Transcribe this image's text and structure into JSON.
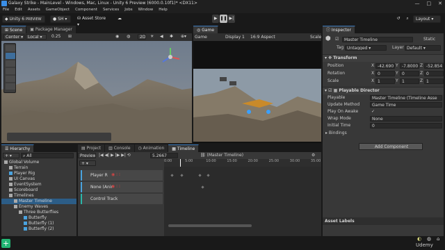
{
  "window": {
    "title": "Galaxy Strike - MainLevel - Windows, Mac, Linux - Unity 6 Preview (6000.0.10f1)* <DX11>",
    "controls": [
      "—",
      "□",
      "✕"
    ]
  },
  "menu": [
    "File",
    "Edit",
    "Assets",
    "GameObject",
    "Component",
    "Services",
    "Jobs",
    "Window",
    "Help"
  ],
  "toolbar": {
    "brand": "Unity 6",
    "preview_tag": "PREVIEW",
    "account": "SH",
    "asset_store": "Asset Store",
    "layout": "Layout"
  },
  "scene": {
    "tabs": [
      "Scene",
      "Package Manager"
    ],
    "pivot": "Center",
    "space": "Local",
    "snap": "0.25",
    "mode_2d": "2D"
  },
  "game": {
    "tab": "Game",
    "display_type": "Game",
    "display": "Display 1",
    "aspect": "16:9 Aspect",
    "scale": "Scale"
  },
  "hierarchy": {
    "tab": "Hierarchy",
    "search": "All",
    "items": [
      {
        "label": "Global Volume",
        "depth": 0,
        "blue": false
      },
      {
        "label": "Terrain",
        "depth": 1,
        "blue": false
      },
      {
        "label": "Player Rig",
        "depth": 1,
        "blue": true
      },
      {
        "label": "UI Canvas",
        "depth": 1,
        "blue": false
      },
      {
        "label": "EventSystem",
        "depth": 1,
        "blue": false
      },
      {
        "label": "Scoreboard",
        "depth": 1,
        "blue": false
      },
      {
        "label": "Timelines",
        "depth": 1,
        "blue": false
      },
      {
        "label": "Master Timeline",
        "depth": 2,
        "blue": false,
        "selected": true
      },
      {
        "label": "Enemy Waves",
        "depth": 2,
        "blue": false
      },
      {
        "label": "Three Butterflies",
        "depth": 3,
        "blue": false
      },
      {
        "label": "Butterfly",
        "depth": 4,
        "blue": true
      },
      {
        "label": "Butterfly (1)",
        "depth": 4,
        "blue": true
      },
      {
        "label": "Butterfly (2)",
        "depth": 4,
        "blue": true
      }
    ]
  },
  "bottom_tabs": [
    "Project",
    "Console",
    "Animation",
    "Timeline"
  ],
  "timeline": {
    "preview": "Preview",
    "time": "5.2667",
    "asset_path": "(Master Timeline)",
    "ruler": [
      "0:00",
      "5:00",
      "10:00",
      "15:00",
      "20:00",
      "25:00",
      "30:00",
      "35:00"
    ],
    "playhead_fraction": 0.1,
    "tracks": [
      "Player R",
      "None (Anir",
      "Control Track"
    ]
  },
  "inspector": {
    "tab": "Inspector",
    "object_name": "Master Timeline",
    "static": "Static",
    "tag_label": "Tag",
    "tag": "Untagged",
    "layer_label": "Layer",
    "layer": "Default",
    "transform": {
      "title": "Transform",
      "rows": [
        {
          "label": "Position",
          "x": "-42.690",
          "y": "-7.8000",
          "z": "-52.854"
        },
        {
          "label": "Rotation",
          "x": "0",
          "y": "0",
          "z": "0"
        },
        {
          "label": "Scale",
          "x": "1",
          "y": "1",
          "z": "1"
        }
      ]
    },
    "director": {
      "title": "Playable Director",
      "rows": [
        {
          "label": "Playable",
          "value": "Master Timeline (Timeline Asse"
        },
        {
          "label": "Update Method",
          "value": "Game Time"
        },
        {
          "label": "Play On Awake",
          "value": "✓"
        },
        {
          "label": "Wrap Mode",
          "value": "None"
        },
        {
          "label": "Initial Time",
          "value": "0"
        }
      ],
      "bindings": "Bindings"
    },
    "add_component": "Add Component",
    "asset_labels": "Asset Labels"
  },
  "status": {
    "brand": "Udemy"
  },
  "colors": {
    "accent": "#4aa3df",
    "selection": "#2c5d87",
    "panel": "#383838"
  }
}
